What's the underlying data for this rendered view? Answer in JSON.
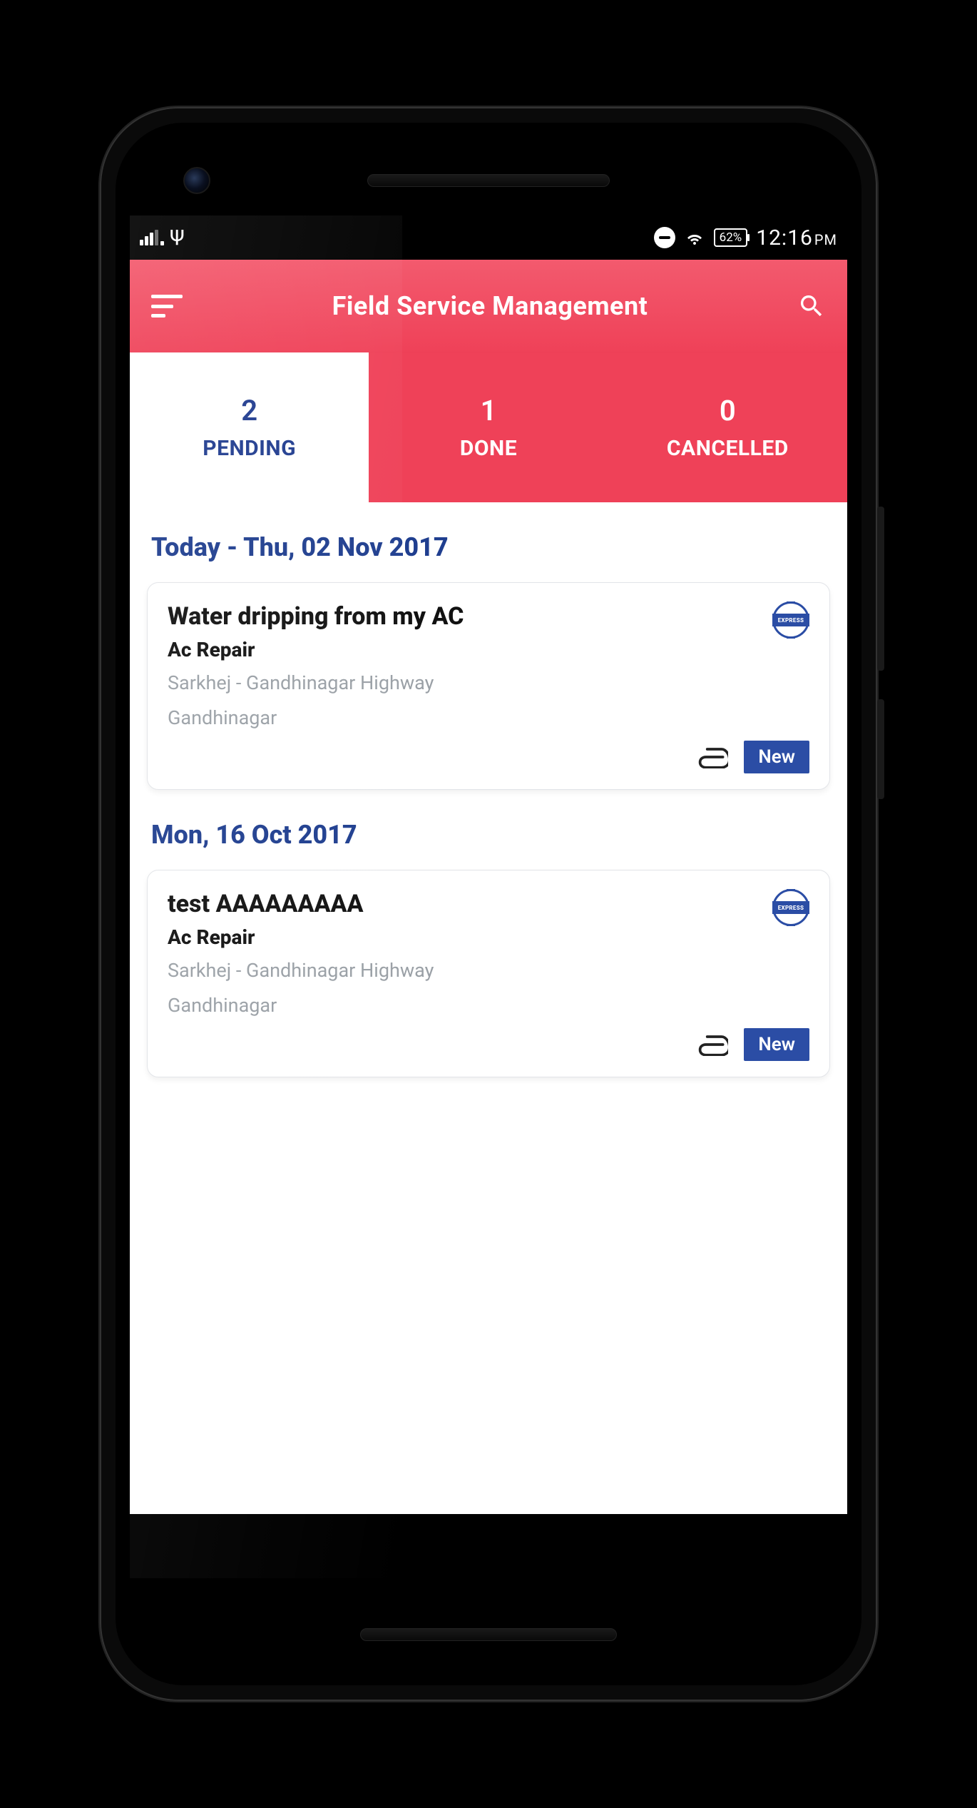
{
  "statusbar": {
    "battery": "62%",
    "time": "12:16",
    "meridiem": "PM"
  },
  "appbar": {
    "title": "Field Service Management"
  },
  "tabs": [
    {
      "count": "2",
      "label": "PENDING",
      "active": true
    },
    {
      "count": "1",
      "label": "DONE",
      "active": false
    },
    {
      "count": "0",
      "label": "CANCELLED",
      "active": false
    }
  ],
  "sections": [
    {
      "header": "Today - Thu, 02 Nov 2017",
      "card": {
        "title": "Water dripping from my AC",
        "subtitle": "Ac Repair",
        "loc1": "Sarkhej - Gandhinagar Highway",
        "loc2": "Gandhinagar",
        "express": "EXPRESS",
        "status": "New"
      }
    },
    {
      "header": "Mon, 16 Oct 2017",
      "card": {
        "title": "test AAAAAAAAA",
        "subtitle": "Ac Repair",
        "loc1": "Sarkhej - Gandhinagar Highway",
        "loc2": "Gandhinagar",
        "express": "EXPRESS",
        "status": "New"
      }
    }
  ]
}
